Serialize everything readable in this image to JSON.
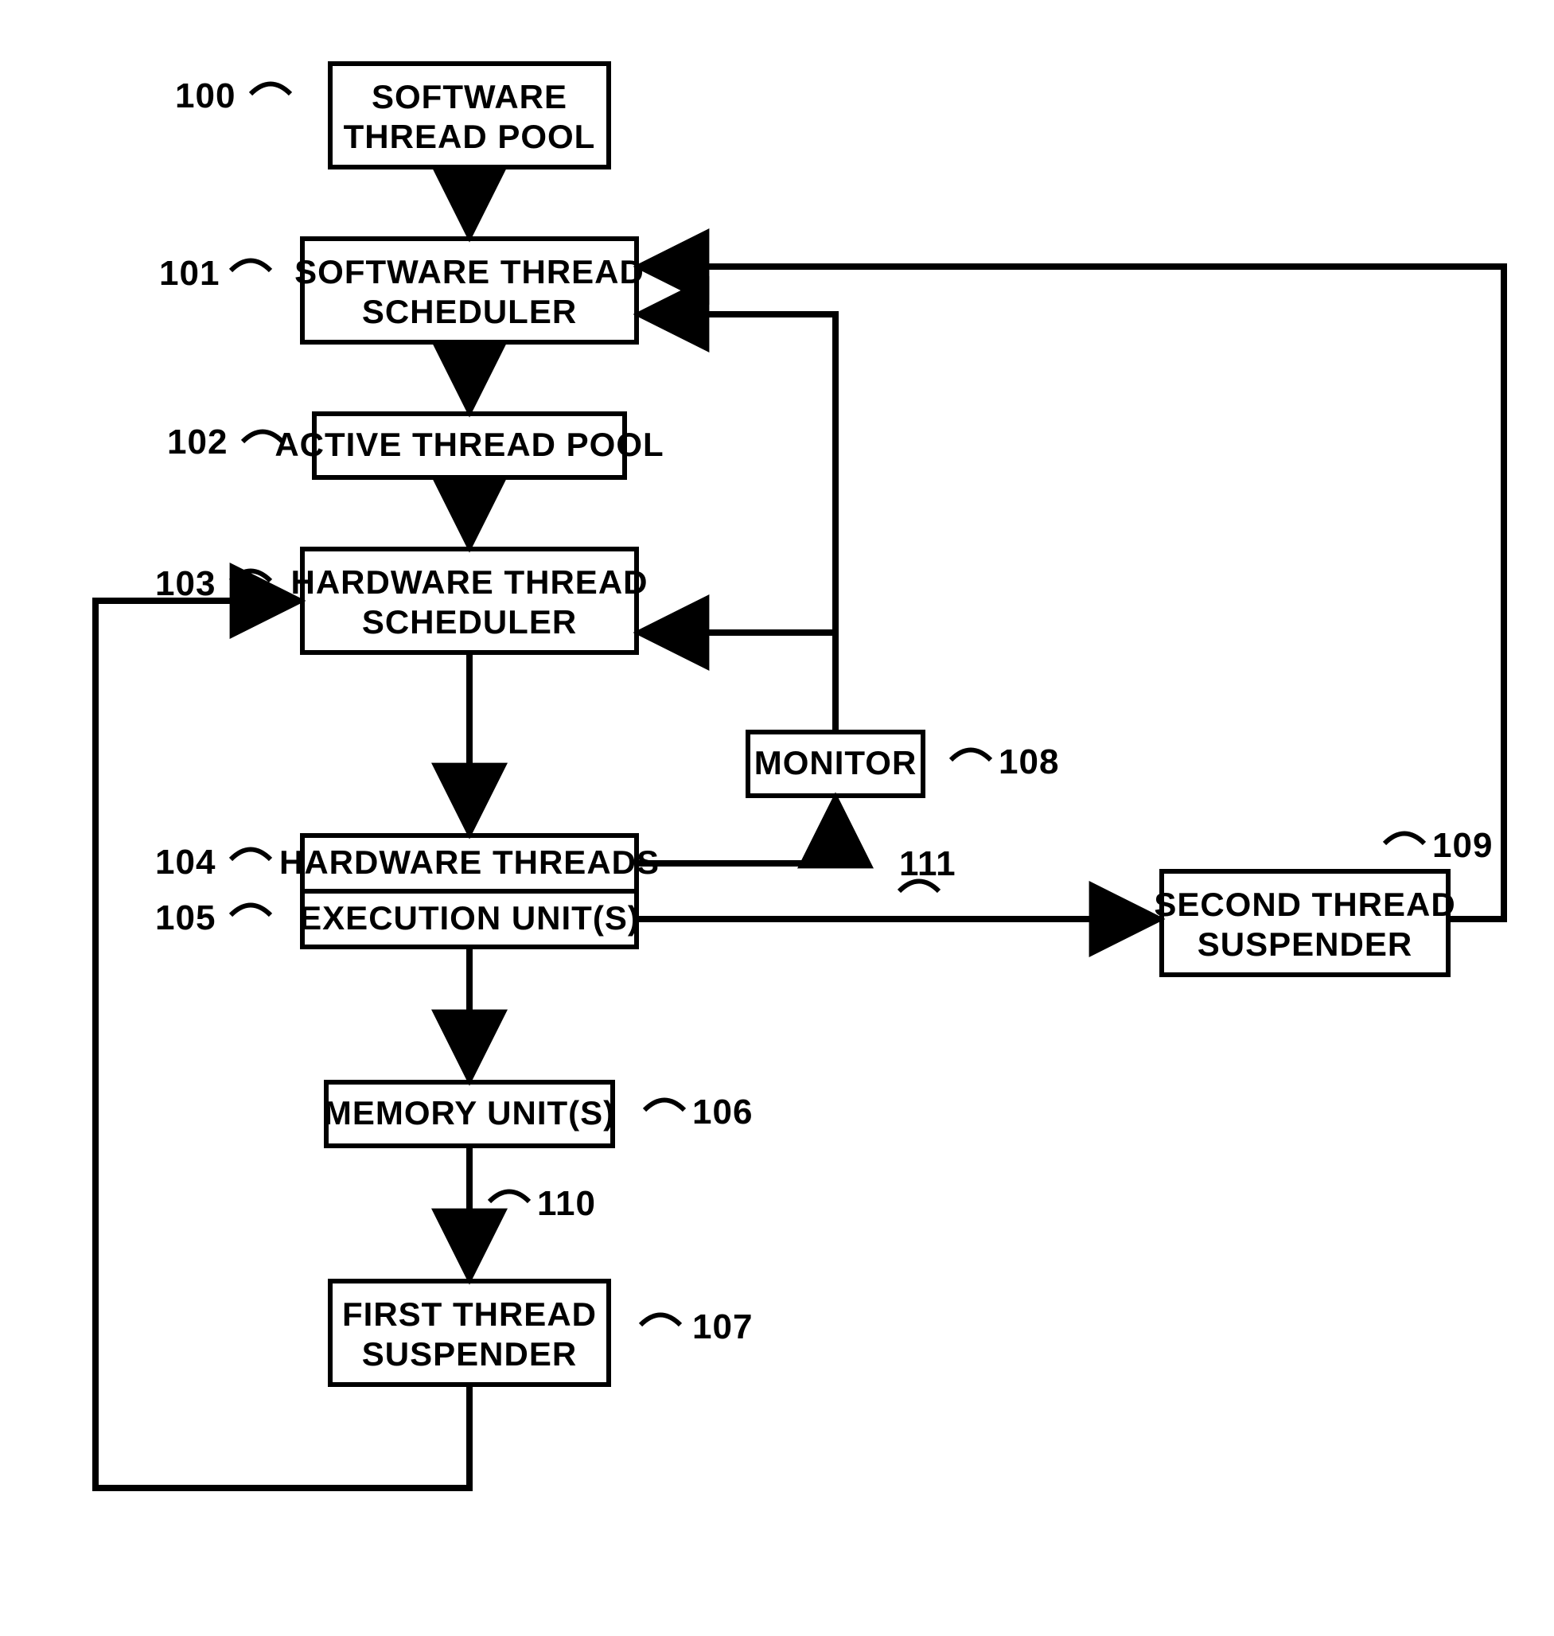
{
  "blocks": {
    "b100": {
      "ref": "100",
      "line1": "SOFTWARE",
      "line2": "THREAD POOL"
    },
    "b101": {
      "ref": "101",
      "line1": "SOFTWARE THREAD",
      "line2": "SCHEDULER"
    },
    "b102": {
      "ref": "102",
      "line1": "ACTIVE THREAD POOL"
    },
    "b103": {
      "ref": "103",
      "line1": "HARDWARE THREAD",
      "line2": "SCHEDULER"
    },
    "b104": {
      "ref": "104",
      "line1": "HARDWARE THREADS"
    },
    "b105": {
      "ref": "105",
      "line1": "EXECUTION UNIT(S)"
    },
    "b106": {
      "ref": "106",
      "line1": "MEMORY UNIT(S)"
    },
    "b107": {
      "ref": "107",
      "line1": "FIRST THREAD",
      "line2": "SUSPENDER"
    },
    "b108": {
      "ref": "108",
      "line1": "MONITOR"
    },
    "b109": {
      "ref": "109",
      "line1": "SECOND THREAD",
      "line2": "SUSPENDER"
    }
  },
  "edge_refs": {
    "e110": "110",
    "e111": "111"
  }
}
